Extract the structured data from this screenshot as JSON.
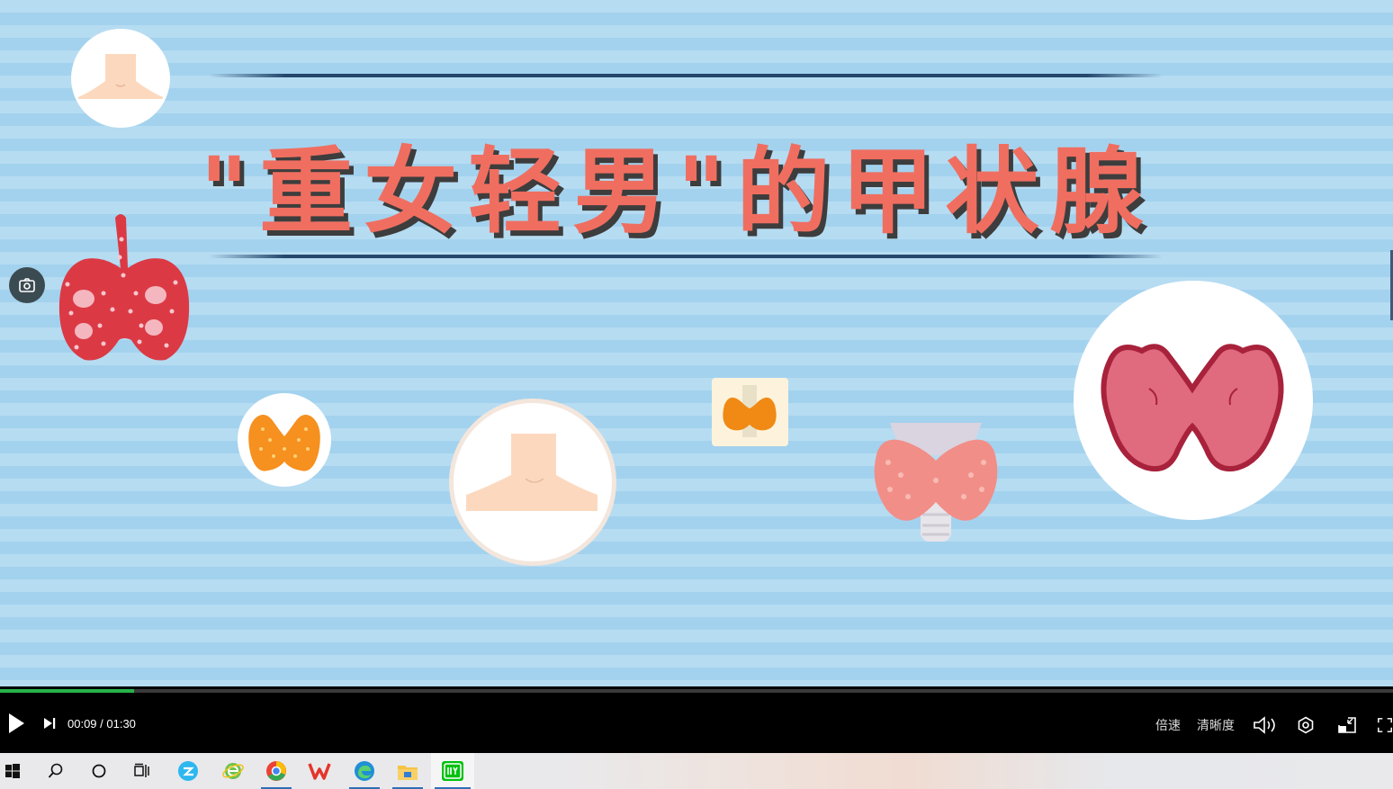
{
  "video": {
    "title_text": "\"重女轻男\"的甲状腺"
  },
  "player": {
    "time_display": "00:09 / 01:30",
    "progress": 0.096,
    "speed_label": "倍速",
    "quality_label": "清晰度"
  },
  "colors": {
    "title": "#f06e60",
    "progress": "#27b24a",
    "background_stripe": "#b6dcf2"
  },
  "icons": {
    "screenshot": "camera-icon",
    "play": "play-icon",
    "next": "next-icon",
    "volume": "volume-icon",
    "settings": "settings-icon",
    "pip": "picture-in-picture-icon",
    "fullscreen": "fullscreen-icon"
  },
  "taskbar": {
    "items": [
      "windows-start-icon",
      "search-icon",
      "cortana-icon",
      "task-view-icon",
      "browser-e-icon",
      "ie-icon",
      "color-app-icon",
      "wps-icon",
      "edge-icon",
      "file-explorer-icon",
      "iqiyi-icon"
    ]
  }
}
